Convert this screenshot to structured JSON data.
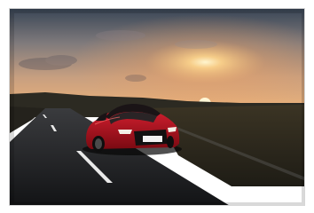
{
  "photo": {
    "subject": "red-sports-car",
    "plate_text": "",
    "colors": {
      "sky_top": "#2f3b4a",
      "sky_mid": "#c7a081",
      "sun": "#fff3c4",
      "car_red": "#b3101e",
      "road": "#1b1d20"
    }
  }
}
